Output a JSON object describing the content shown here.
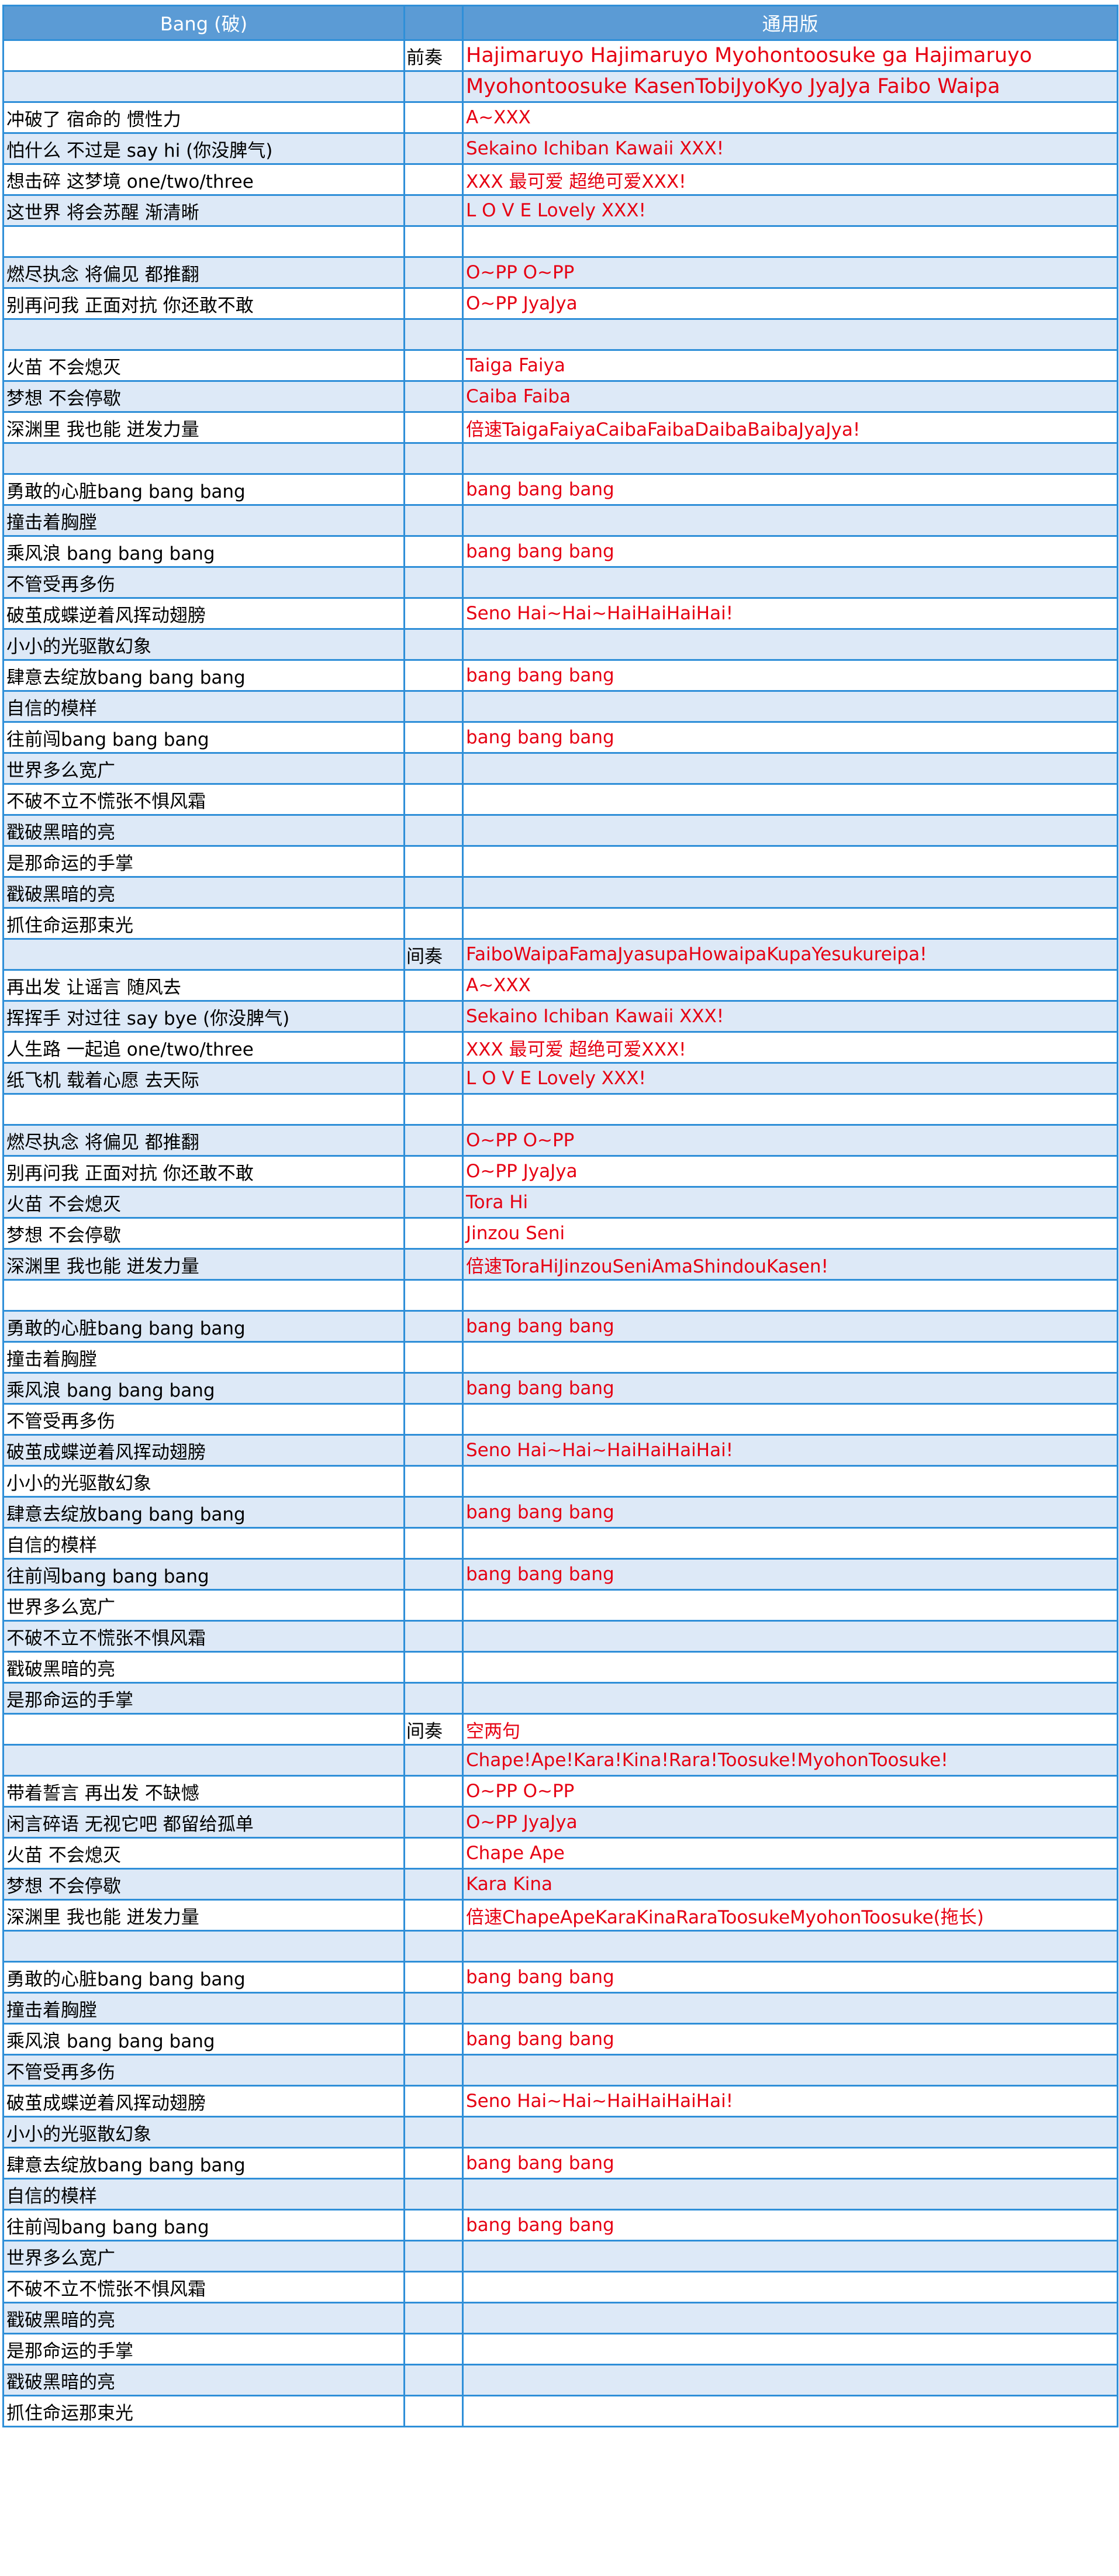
{
  "header": {
    "col1": "Bang (破)",
    "col2": "",
    "col3": "通用版"
  },
  "rows": [
    {
      "a": "",
      "b": "前奏",
      "c": "Hajimaruyo Hajimaruyo Myohontoosuke ga Hajimaruyo"
    },
    {
      "a": "",
      "b": "",
      "c": "Myohontoosuke KasenTobiJyoKyo JyaJya Faibo Waipa"
    },
    {
      "a": "冲破了 宿命的 惯性力",
      "b": "",
      "c": "A~XXX"
    },
    {
      "a": "怕什么 不过是 say hi (你没脾气)",
      "b": "",
      "c": "Sekaino Ichiban Kawaii XXX!"
    },
    {
      "a": "想击碎 这梦境 one/two/three",
      "b": "",
      "c": "XXX 最可爱 超绝可爱XXX!"
    },
    {
      "a": "这世界 将会苏醒 渐清晰",
      "b": "",
      "c": "L O V E Lovely XXX!"
    },
    {
      "a": "",
      "b": "",
      "c": ""
    },
    {
      "a": "燃尽执念 将偏见 都推翻",
      "b": "",
      "c": "O~PP O~PP"
    },
    {
      "a": "别再问我 正面对抗 你还敢不敢",
      "b": "",
      "c": "O~PP JyaJya"
    },
    {
      "a": "",
      "b": "",
      "c": ""
    },
    {
      "a": "火苗 不会熄灭",
      "b": "",
      "c": "Taiga Faiya"
    },
    {
      "a": "梦想 不会停歇",
      "b": "",
      "c": "Caiba Faiba"
    },
    {
      "a": "深渊里 我也能 迸发力量",
      "b": "",
      "c": "倍速TaigaFaiyaCaibaFaibaDaibaBaibaJyaJya!"
    },
    {
      "a": "",
      "b": "",
      "c": ""
    },
    {
      "a": "勇敢的心脏bang bang bang",
      "b": "",
      "c": "bang bang bang"
    },
    {
      "a": "撞击着胸膛",
      "b": "",
      "c": ""
    },
    {
      "a": "乘风浪 bang bang bang",
      "b": "",
      "c": "bang bang bang"
    },
    {
      "a": "不管受再多伤",
      "b": "",
      "c": ""
    },
    {
      "a": "破茧成蝶逆着风挥动翅膀",
      "b": "",
      "c": "Seno Hai~Hai~HaiHaiHaiHai!"
    },
    {
      "a": "小小的光驱散幻象",
      "b": "",
      "c": ""
    },
    {
      "a": "肆意去绽放bang bang bang",
      "b": "",
      "c": "bang bang bang"
    },
    {
      "a": "自信的模样",
      "b": "",
      "c": ""
    },
    {
      "a": "往前闯bang bang bang",
      "b": "",
      "c": "bang bang bang"
    },
    {
      "a": "世界多么宽广",
      "b": "",
      "c": ""
    },
    {
      "a": "不破不立不慌张不惧风霜",
      "b": "",
      "c": ""
    },
    {
      "a": "戳破黑暗的亮",
      "b": "",
      "c": ""
    },
    {
      "a": "是那命运的手掌",
      "b": "",
      "c": ""
    },
    {
      "a": "戳破黑暗的亮",
      "b": "",
      "c": ""
    },
    {
      "a": "抓住命运那束光",
      "b": "",
      "c": ""
    },
    {
      "a": "",
      "b": "间奏",
      "c": "FaiboWaipaFamaJyasupaHowaipaKupaYesukureipa!"
    },
    {
      "a": "再出发 让谣言 随风去",
      "b": "",
      "c": "A~XXX"
    },
    {
      "a": "挥挥手 对过往 say bye (你没脾气)",
      "b": "",
      "c": "Sekaino Ichiban Kawaii XXX!"
    },
    {
      "a": "人生路 一起追 one/two/three",
      "b": "",
      "c": "XXX 最可爱 超绝可爱XXX!"
    },
    {
      "a": "纸飞机 载着心愿 去天际",
      "b": "",
      "c": "L O V E Lovely XXX!"
    },
    {
      "a": "",
      "b": "",
      "c": ""
    },
    {
      "a": "燃尽执念 将偏见 都推翻",
      "b": "",
      "c": "O~PP O~PP"
    },
    {
      "a": "别再问我 正面对抗 你还敢不敢",
      "b": "",
      "c": "O~PP JyaJya"
    },
    {
      "a": "火苗 不会熄灭",
      "b": "",
      "c": "Tora Hi"
    },
    {
      "a": "梦想 不会停歇",
      "b": "",
      "c": "Jinzou Seni"
    },
    {
      "a": "深渊里 我也能 迸发力量",
      "b": "",
      "c": "倍速ToraHiJinzouSeniAmaShindouKasen!"
    },
    {
      "a": "",
      "b": "",
      "c": ""
    },
    {
      "a": "勇敢的心脏bang bang bang",
      "b": "",
      "c": "bang bang bang"
    },
    {
      "a": "撞击着胸膛",
      "b": "",
      "c": ""
    },
    {
      "a": "乘风浪 bang bang bang",
      "b": "",
      "c": "bang bang bang"
    },
    {
      "a": "不管受再多伤",
      "b": "",
      "c": ""
    },
    {
      "a": "破茧成蝶逆着风挥动翅膀",
      "b": "",
      "c": "Seno Hai~Hai~HaiHaiHaiHai!"
    },
    {
      "a": "小小的光驱散幻象",
      "b": "",
      "c": ""
    },
    {
      "a": "肆意去绽放bang bang bang",
      "b": "",
      "c": "bang bang bang"
    },
    {
      "a": "自信的模样",
      "b": "",
      "c": ""
    },
    {
      "a": "往前闯bang bang bang",
      "b": "",
      "c": "bang bang bang"
    },
    {
      "a": "世界多么宽广",
      "b": "",
      "c": ""
    },
    {
      "a": "不破不立不慌张不惧风霜",
      "b": "",
      "c": ""
    },
    {
      "a": "戳破黑暗的亮",
      "b": "",
      "c": ""
    },
    {
      "a": "是那命运的手掌",
      "b": "",
      "c": ""
    },
    {
      "a": "",
      "b": "间奏",
      "c": "空两句"
    },
    {
      "a": "",
      "b": "",
      "c": "Chape!Ape!Kara!Kina!Rara!Toosuke!MyohonToosuke!"
    },
    {
      "a": "带着誓言 再出发 不缺憾",
      "b": "",
      "c": "O~PP O~PP"
    },
    {
      "a": "闲言碎语 无视它吧 都留给孤单",
      "b": "",
      "c": "O~PP JyaJya"
    },
    {
      "a": "火苗 不会熄灭",
      "b": "",
      "c": "Chape Ape"
    },
    {
      "a": "梦想 不会停歇",
      "b": "",
      "c": "Kara Kina"
    },
    {
      "a": "深渊里 我也能 迸发力量",
      "b": "",
      "c": "倍速ChapeApeKaraKinaRaraToosukeMyohonToosuke(拖长)"
    },
    {
      "a": "",
      "b": "",
      "c": ""
    },
    {
      "a": "勇敢的心脏bang bang bang",
      "b": "",
      "c": "bang bang bang"
    },
    {
      "a": "撞击着胸膛",
      "b": "",
      "c": ""
    },
    {
      "a": "乘风浪 bang bang bang",
      "b": "",
      "c": "bang bang bang"
    },
    {
      "a": "不管受再多伤",
      "b": "",
      "c": ""
    },
    {
      "a": "破茧成蝶逆着风挥动翅膀",
      "b": "",
      "c": "Seno Hai~Hai~HaiHaiHaiHai!"
    },
    {
      "a": "小小的光驱散幻象",
      "b": "",
      "c": ""
    },
    {
      "a": "肆意去绽放bang bang bang",
      "b": "",
      "c": "bang bang bang"
    },
    {
      "a": "自信的模样",
      "b": "",
      "c": ""
    },
    {
      "a": "往前闯bang bang bang",
      "b": "",
      "c": "bang bang bang"
    },
    {
      "a": "世界多么宽广",
      "b": "",
      "c": ""
    },
    {
      "a": "不破不立不慌张不惧风霜",
      "b": "",
      "c": ""
    },
    {
      "a": "戳破黑暗的亮",
      "b": "",
      "c": ""
    },
    {
      "a": "是那命运的手掌",
      "b": "",
      "c": ""
    },
    {
      "a": "戳破黑暗的亮",
      "b": "",
      "c": ""
    },
    {
      "a": "抓住命运那束光",
      "b": "",
      "c": ""
    }
  ],
  "colors": {
    "header_bg": "#5b9bd5",
    "header_text": "#ffffff",
    "grid_line": "#2f8fd8",
    "alt_row_bg": "#dde9f7",
    "romaji_text": "#e60012",
    "lyric_text": "#000000"
  }
}
